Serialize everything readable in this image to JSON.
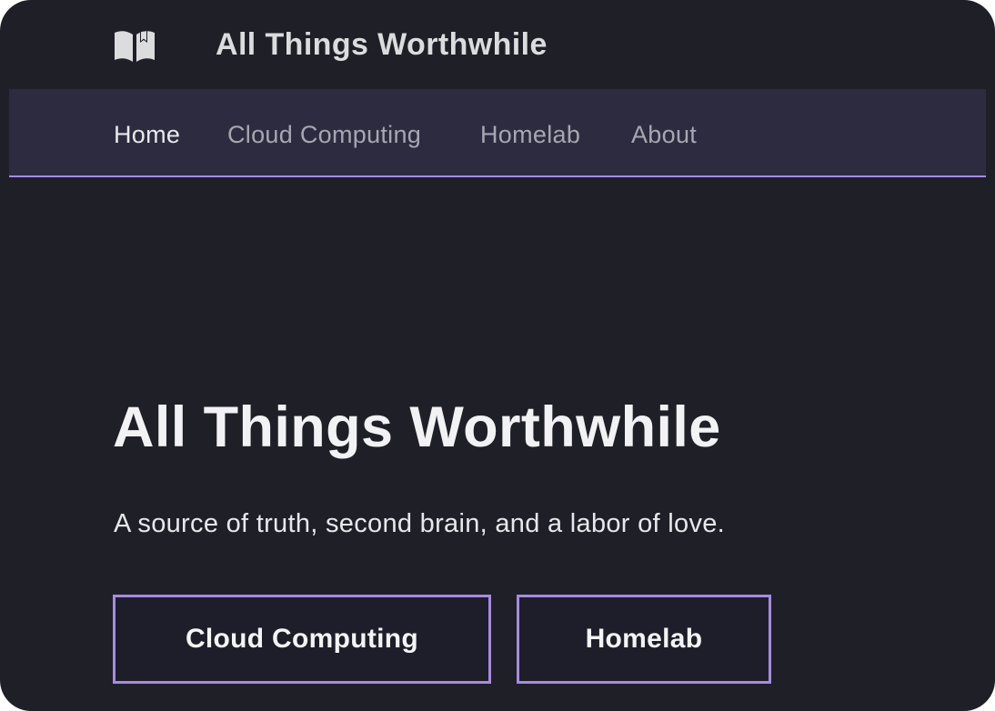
{
  "header": {
    "logo_icon": "open-book-icon",
    "site_title": "All Things Worthwhile"
  },
  "nav": {
    "items": [
      {
        "label": "Home",
        "active": true
      },
      {
        "label": "Cloud Computing",
        "active": false
      },
      {
        "label": "Homelab",
        "active": false
      },
      {
        "label": "About",
        "active": false
      }
    ]
  },
  "hero": {
    "title": "All Things Worthwhile",
    "tagline": "A source of truth, second brain, and a labor of love.",
    "buttons": [
      {
        "label": "Cloud Computing"
      },
      {
        "label": "Homelab"
      }
    ]
  },
  "colors": {
    "background": "#1f1f28",
    "nav_background": "#2d2b3f",
    "accent": "#a78bdf"
  }
}
